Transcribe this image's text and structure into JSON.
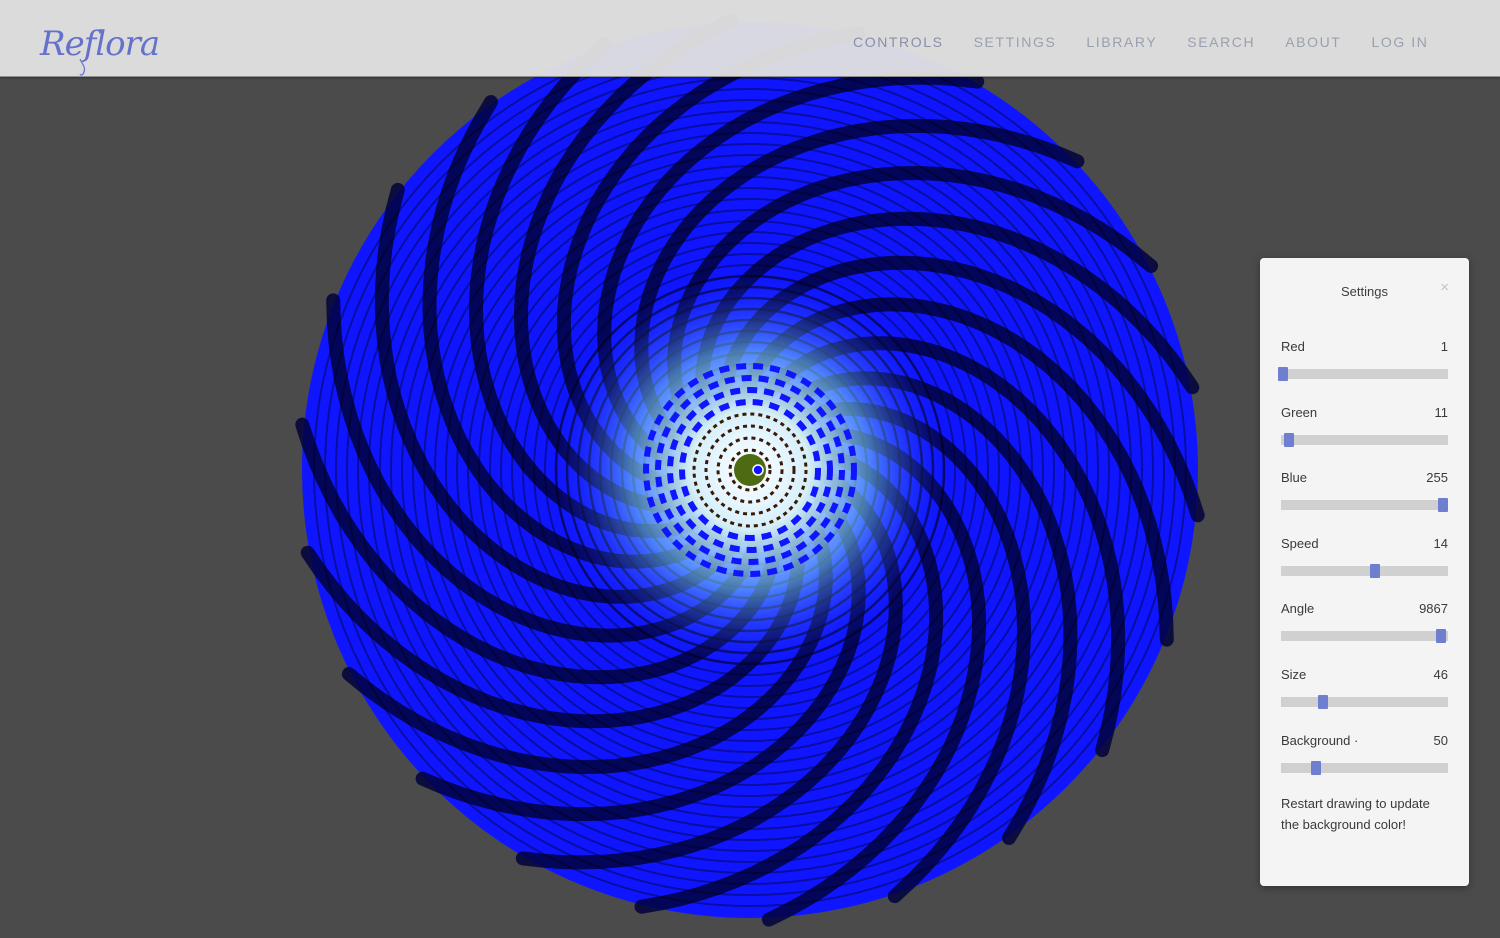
{
  "brand": {
    "logo_text": "Reflora"
  },
  "nav": {
    "items": [
      {
        "label": "CONTROLS",
        "name": "nav-controls"
      },
      {
        "label": "SETTINGS",
        "name": "nav-settings"
      },
      {
        "label": "LIBRARY",
        "name": "nav-library"
      },
      {
        "label": "SEARCH",
        "name": "nav-search"
      },
      {
        "label": "ABOUT",
        "name": "nav-about"
      },
      {
        "label": "LOG IN",
        "name": "nav-log-in"
      }
    ]
  },
  "settings": {
    "title": "Settings",
    "close_icon": "×",
    "controls": [
      {
        "label": "Red",
        "value": "1",
        "fraction": 0.01
      },
      {
        "label": "Green",
        "value": "11",
        "fraction": 0.05
      },
      {
        "label": "Blue",
        "value": "255",
        "fraction": 0.97
      },
      {
        "label": "Speed",
        "value": "14",
        "fraction": 0.56
      },
      {
        "label": "Angle",
        "value": "9867",
        "fraction": 0.96
      },
      {
        "label": "Size",
        "value": "46",
        "fraction": 0.25
      },
      {
        "label": "Background ·",
        "value": "50",
        "fraction": 0.21
      }
    ],
    "note": "Restart drawing to update the background color!"
  },
  "colors": {
    "background": "#4b4b4b",
    "petal": "#0f16ff",
    "petal_shadow": "#01023c",
    "center_glow": "#dffbff",
    "center_core": "#4f6b12",
    "slider_thumb": "#6e7fcf",
    "logo": "#6472cc"
  }
}
